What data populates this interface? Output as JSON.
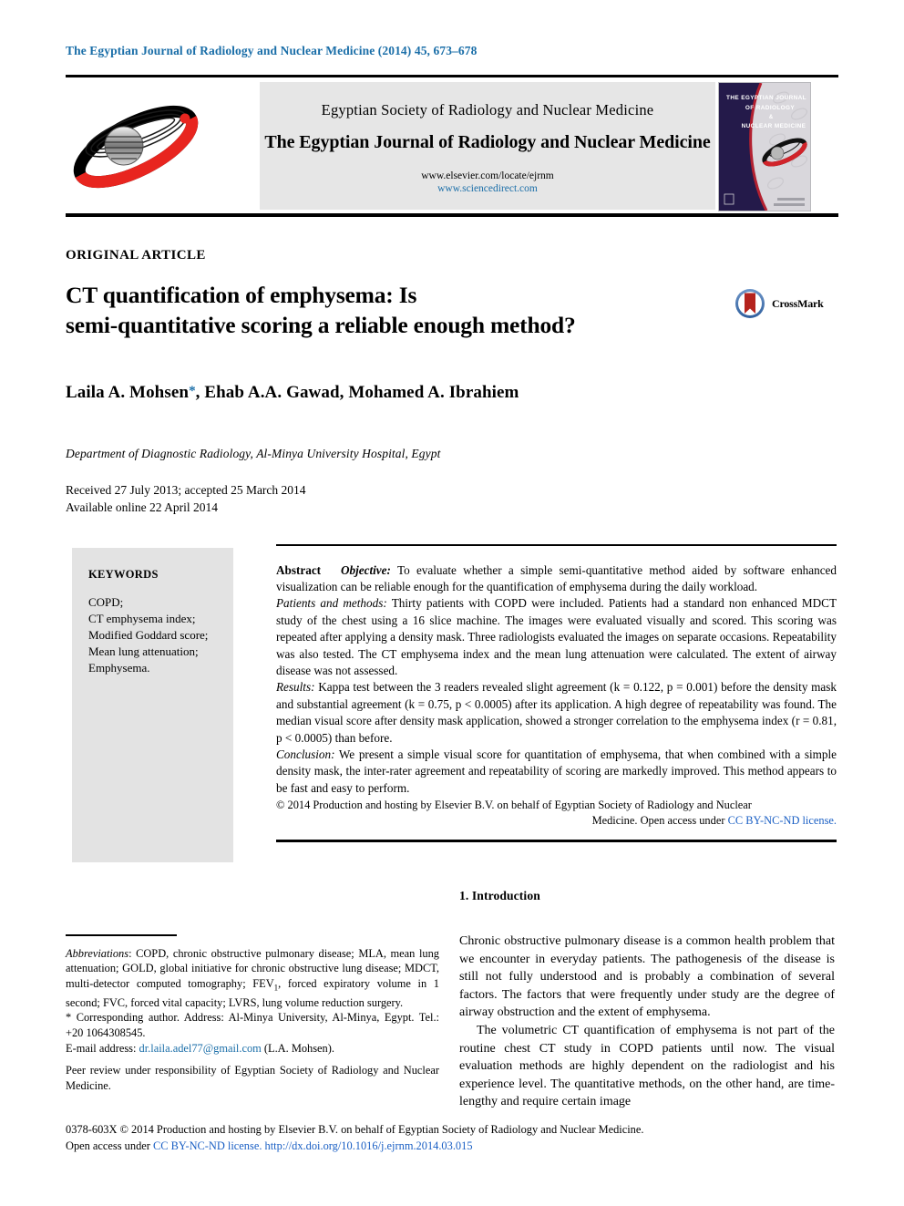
{
  "running_head": "The Egyptian Journal of Radiology and Nuclear Medicine (2014) 45, 673–678",
  "masthead": {
    "society": "Egyptian Society of Radiology and Nuclear Medicine",
    "journal_title": "The Egyptian Journal of Radiology and Nuclear Medicine",
    "url_elsevier": "www.elsevier.com/locate/ejrnm",
    "url_sciencedirect": "www.sciencedirect.com",
    "cover_title_line1": "THE EGYPTIAN JOURNAL",
    "cover_title_line2": "OF RADIOLOGY",
    "cover_title_line3": "&",
    "cover_title_line4": "NUCLEAR MEDICINE"
  },
  "article": {
    "type": "ORIGINAL ARTICLE",
    "title_line1": "CT quantification of emphysema: Is",
    "title_line2": "semi-quantitative scoring a reliable enough method?",
    "crossmark_label": "CrossMark",
    "authors": "Laila A. Mohsen",
    "author_star": "*",
    "authors_rest": ", Ehab A.A. Gawad, Mohamed A. Ibrahiem",
    "affiliation": "Department of Diagnostic Radiology, Al-Minya University Hospital, Egypt",
    "received": "Received 27 July 2013; accepted 25 March 2014",
    "available": "Available online 22 April 2014"
  },
  "keywords": {
    "heading": "KEYWORDS",
    "items": [
      "COPD;",
      "CT emphysema index;",
      "Modified Goddard score;",
      "Mean lung attenuation;",
      "Emphysema."
    ]
  },
  "abstract": {
    "label": "Abstract",
    "objective_label": "Objective:",
    "objective_text": "To evaluate whether a simple semi-quantitative method aided by software enhanced visualization can be reliable enough for the quantification of emphysema during the daily workload.",
    "methods_label": "Patients and methods:",
    "methods_text": "Thirty patients with COPD were included. Patients had a standard non enhanced MDCT study of the chest using a 16 slice machine. The images were evaluated visually and scored. This scoring was repeated after applying a density mask. Three radiologists evaluated the images on separate occasions. Repeatability was also tested. The CT emphysema index and the mean lung attenuation were calculated. The extent of airway disease was not assessed.",
    "results_label": "Results:",
    "results_text": "Kappa test between the 3 readers revealed slight agreement (k = 0.122, p = 0.001) before the density mask and substantial agreement (k = 0.75, p < 0.0005) after its application. A high degree of repeatability was found. The median visual score after density mask application, showed a stronger correlation to the emphysema index (r = 0.81, p < 0.0005) than before.",
    "conclusion_label": "Conclusion:",
    "conclusion_text": "We present a simple visual score for quantitation of emphysema, that when combined with a simple density mask, the inter-rater agreement and repeatability of scoring are markedly improved. This method appears to be fast and easy to perform.",
    "copyright_text": "© 2014 Production and hosting by Elsevier B.V. on behalf of Egyptian Society of Radiology and Nuclear",
    "copyright_text_end": "Medicine. Open access under",
    "license_link": "CC BY-NC-ND license."
  },
  "introduction": {
    "heading": "1. Introduction",
    "paragraph1": "Chronic obstructive pulmonary disease is a common health problem that we encounter in everyday patients. The pathogenesis of the disease is still not fully understood and is probably a combination of several factors. The factors that were frequently under study are the degree of airway obstruction and the extent of emphysema.",
    "paragraph2": "The volumetric CT quantification of emphysema is not part of the routine chest CT study in COPD patients until now. The visual evaluation methods are highly dependent on the radiologist and his experience level. The quantitative methods, on the other hand, are time-lengthy and require certain image"
  },
  "footnotes": {
    "abbreviations_label": "Abbreviations",
    "abbreviations_text_a": ": COPD, chronic obstructive pulmonary disease; MLA, mean lung attenuation; GOLD, global initiative for chronic obstructive lung disease; MDCT, multi-detector computed tomography; FEV",
    "abbreviations_sub": "1",
    "abbreviations_text_b": ", forced expiratory volume in 1 second; FVC, forced vital capacity; LVRS, lung volume reduction surgery.",
    "corresponding_star": "*",
    "corresponding_text": "Corresponding author. Address: Al-Minya University, Al-Minya, Egypt. Tel.: +20 1064308545.",
    "email_label": "E-mail address:",
    "email_address": "dr.laila.adel77@gmail.com",
    "email_suffix": "(L.A. Mohsen).",
    "peer_review": "Peer review under responsibility of Egyptian Society of Radiology and Nuclear Medicine."
  },
  "page_footer": {
    "line1": "0378-603X © 2014 Production and hosting by Elsevier B.V. on behalf of Egyptian Society of Radiology and Nuclear Medicine.",
    "open_access_prefix": "Open access under",
    "license_link": "CC BY-NC-ND license.",
    "doi": "http://dx.doi.org/10.1016/j.ejrnm.2014.03.015"
  },
  "colors": {
    "link_blue": "#1a6ea8",
    "license_blue": "#1a5fc4",
    "logo_red": "#e8251f",
    "cover_navy": "#241a4a"
  }
}
